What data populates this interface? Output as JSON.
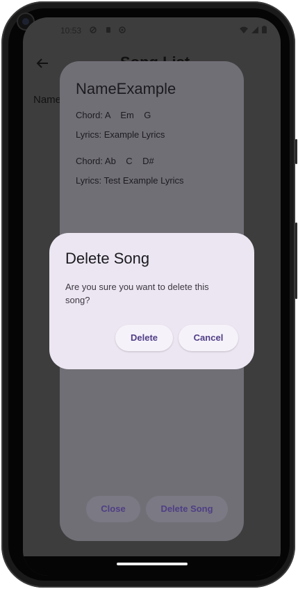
{
  "status_bar": {
    "time": "10:53",
    "icons": [
      "shield-icon",
      "sim-icon",
      "face-icon",
      "wifi-icon",
      "signal-icon",
      "battery-icon"
    ]
  },
  "app_bar": {
    "back_icon": "arrow-back-icon",
    "title": "Song List"
  },
  "list": {
    "item_label": "Name"
  },
  "song_sheet": {
    "title": "NameExample",
    "entries": [
      {
        "chord": "Chord: A    Em    G",
        "lyrics": "Lyrics: Example Lyrics"
      },
      {
        "chord": "Chord: Ab    C    D#",
        "lyrics": "Lyrics: Test Example Lyrics"
      }
    ],
    "close_label": "Close",
    "delete_song_label": "Delete Song"
  },
  "delete_dialog": {
    "title": "Delete Song",
    "message": "Are you sure you want to delete this song?",
    "delete_label": "Delete",
    "cancel_label": "Cancel"
  },
  "colors": {
    "dialog_bg": "#ece6f2",
    "button_text": "#4f3e86",
    "sheet_bg": "#716f76",
    "scrim": "#3d3d3d"
  }
}
